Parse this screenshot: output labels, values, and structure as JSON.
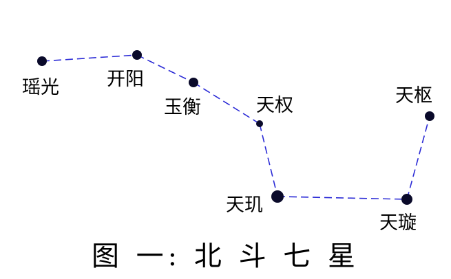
{
  "caption": "图 一: 北 斗 七 星",
  "colors": {
    "line": "#2b2bd6",
    "star": "#0a0a2a",
    "text": "#000000",
    "background": "#ffffff"
  },
  "stars": [
    {
      "id": "yaoguang",
      "name": "瑶光"
    },
    {
      "id": "kaiyang",
      "name": "开阳"
    },
    {
      "id": "yuheng",
      "name": "玉衡"
    },
    {
      "id": "tianquan",
      "name": "天权"
    },
    {
      "id": "tianji",
      "name": "天玑"
    },
    {
      "id": "tianxuan",
      "name": "天璇"
    },
    {
      "id": "tianshu",
      "name": "天枢"
    }
  ],
  "connections": [
    [
      "yaoguang",
      "kaiyang"
    ],
    [
      "kaiyang",
      "yuheng"
    ],
    [
      "yuheng",
      "tianquan"
    ],
    [
      "tianquan",
      "tianji"
    ],
    [
      "tianji",
      "tianxuan"
    ],
    [
      "tianxuan",
      "tianshu"
    ]
  ]
}
